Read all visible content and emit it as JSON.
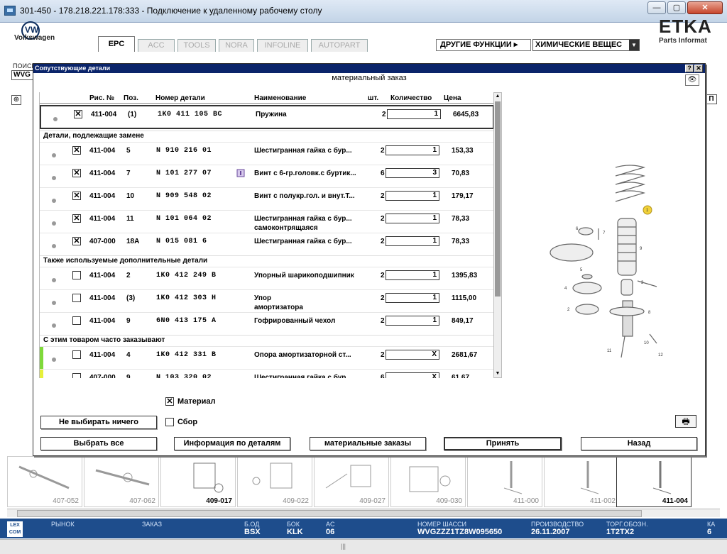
{
  "window": {
    "title": "301-450 - 178.218.221.178:333 - Подключение к удаленному рабочему столу",
    "btn_min": "—",
    "btn_max": "▢",
    "btn_close": "✕"
  },
  "app": {
    "brand_label": "Volkswagen",
    "vw_mark": "VW",
    "tabs": [
      "EPC",
      "ACC",
      "TOOLS",
      "NORA",
      "INFOLINE",
      "AUTOPART"
    ],
    "other_functions": "ДРУГИЕ ФУНКЦИИ ▸",
    "chemicals": "ХИМИЧЕСКИЕ ВЕЩЕС",
    "etka_logo": "ETKA",
    "etka_sub": "Parts Informat",
    "search_label": "ПОИСК",
    "search_value": "WVG",
    "zoom": "⊕",
    "right_btn": "П"
  },
  "dialog": {
    "title": "Сопутствующие детали",
    "help": "?",
    "close": "✕",
    "subtitle": "материальный заказ",
    "columns": {
      "fig": "Рис. №",
      "pos": "Поз.",
      "part": "Номер детали",
      "name": "Наименование",
      "unit": "шт.",
      "qty": "Количество",
      "price": "Цена"
    },
    "main_row": {
      "checked": "✕",
      "fig": "411-004",
      "pos": "(1)",
      "part": "1K0 411 105 BC",
      "name": "Пружина",
      "unit": "2",
      "qty": "1",
      "price": "6645,83"
    },
    "sections": [
      {
        "title": "Детали, подлежащие замене",
        "rows": [
          {
            "checked": "✕",
            "fig": "411-004",
            "pos": "5",
            "part": "N  910 216 01",
            "name": "Шестигранная гайка с бур...",
            "name2": "",
            "unit": "2",
            "qty": "1",
            "price": "153,33"
          },
          {
            "checked": "✕",
            "fig": "411-004",
            "pos": "7",
            "part": "N  101 277 07",
            "name": "Винт с 6-гр.головк.с буртик...",
            "name2": "",
            "unit": "6",
            "qty": "3",
            "price": "70,83"
          },
          {
            "checked": "✕",
            "fig": "411-004",
            "pos": "10",
            "part": "N  909 548 02",
            "name": "Винт с полукр.гол. и внут.Т...",
            "name2": "",
            "unit": "2",
            "qty": "1",
            "price": "179,17"
          },
          {
            "checked": "✕",
            "fig": "411-004",
            "pos": "11",
            "part": "N  101 064 02",
            "name": "Шестигранная гайка с бур...",
            "name2": "самоконтрящаяся",
            "unit": "2",
            "qty": "1",
            "price": "78,33"
          },
          {
            "checked": "✕",
            "fig": "407-000",
            "pos": "18A",
            "part": "N  015 081 6",
            "name": "Шестигранная гайка с бур...",
            "name2": "",
            "unit": "2",
            "qty": "1",
            "price": "78,33"
          }
        ]
      },
      {
        "title": "Также используемые дополнительные детали",
        "rows": [
          {
            "checked": "",
            "fig": "411-004",
            "pos": "2",
            "part": "1K0 412 249 B",
            "name": "Упорный шарикоподшипник",
            "name2": "",
            "unit": "2",
            "qty": "1",
            "price": "1395,83"
          },
          {
            "checked": "",
            "fig": "411-004",
            "pos": "(3)",
            "part": "1K0 412 303 H",
            "name": "Упор",
            "name2": "амортизатора",
            "unit": "2",
            "qty": "1",
            "price": "1115,00"
          },
          {
            "checked": "",
            "fig": "411-004",
            "pos": "9",
            "part": "6N0 413 175 A",
            "name": "Гофрированный чехол",
            "name2": "",
            "unit": "2",
            "qty": "1",
            "price": "849,17"
          }
        ]
      },
      {
        "title": "С этим товаром часто заказывают",
        "rows": [
          {
            "checked": "",
            "fig": "411-004",
            "pos": "4",
            "part": "1K0 412 331 B",
            "name": "Опора амортизаторной ст...",
            "name2": "",
            "unit": "2",
            "qty": "X",
            "price": "2681,67",
            "stripe": "#7fd93a"
          },
          {
            "checked": "",
            "fig": "407-000",
            "pos": "9",
            "part": "N  103 320 02",
            "name": "Шестигранная гайка с бур...",
            "name2": "",
            "unit": "6",
            "qty": "X",
            "price": "61,67",
            "stripe": "#e6f03a"
          }
        ]
      }
    ],
    "material_checked": "✕",
    "material_label": "Материал",
    "assembly_label": "Сбор",
    "deselect_all": "Не выбирать ничего",
    "select_all": "Выбрать все",
    "part_info": "Информация по деталям",
    "material_orders": "материальные заказы",
    "accept": "Принять",
    "back": "Назад",
    "print_icon": "🖶",
    "diagram_labels": [
      "1",
      "6",
      "7",
      "9",
      "5",
      "3",
      "4",
      "8",
      "2",
      "10",
      "11",
      "12"
    ]
  },
  "thumbnails": [
    "407-052",
    "407-062",
    "409-017",
    "409-022",
    "409-027",
    "409-030",
    "411-000",
    "411-002",
    "411-004"
  ],
  "status": {
    "market_label": "РЫНОК",
    "order_label": "ЗАКАЗ",
    "bod_label": "Б.ОД",
    "bod_value": "BSX",
    "bok_label": "БОК",
    "bok_value": "KLK",
    "ac_label": "AC",
    "ac_value": "06",
    "chassis_label": "НОМЕР ШАССИ",
    "chassis_value": "WVGZZZ1TZ8W095650",
    "prod_label": "ПРОИЗВОДСТВО",
    "prod_value": "26.11.2007",
    "trade_label": "ТОРГ.ОБОЗН.",
    "trade_value": "1T2TX2",
    "k_label": "КА",
    "k_value": "6",
    "lexcom": "LEX COM"
  },
  "bottom_grip": "|||"
}
